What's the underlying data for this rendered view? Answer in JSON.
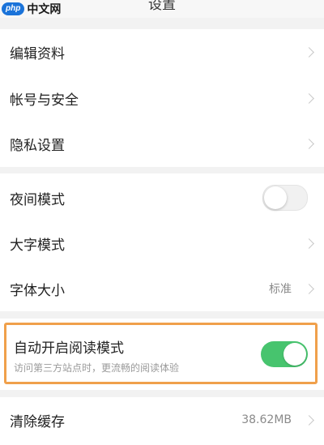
{
  "header": {
    "title": "设置"
  },
  "watermark": {
    "logo": "php",
    "text": "中文网"
  },
  "group1": {
    "items": [
      {
        "label": "编辑资料"
      },
      {
        "label": "帐号与安全"
      },
      {
        "label": "隐私设置"
      }
    ]
  },
  "group2": {
    "items": [
      {
        "label": "夜间模式",
        "toggle": false
      },
      {
        "label": "大字模式"
      },
      {
        "label": "字体大小",
        "value": "标准"
      }
    ]
  },
  "reading_mode": {
    "label": "自动开启阅读模式",
    "description": "访问第三方站点时，更流畅的阅读体验",
    "enabled": true
  },
  "group4": {
    "items": [
      {
        "label": "清除缓存",
        "value": "38.62MB"
      }
    ]
  },
  "colors": {
    "accent_on": "#47c46e",
    "highlight_border": "#f0a04b"
  }
}
